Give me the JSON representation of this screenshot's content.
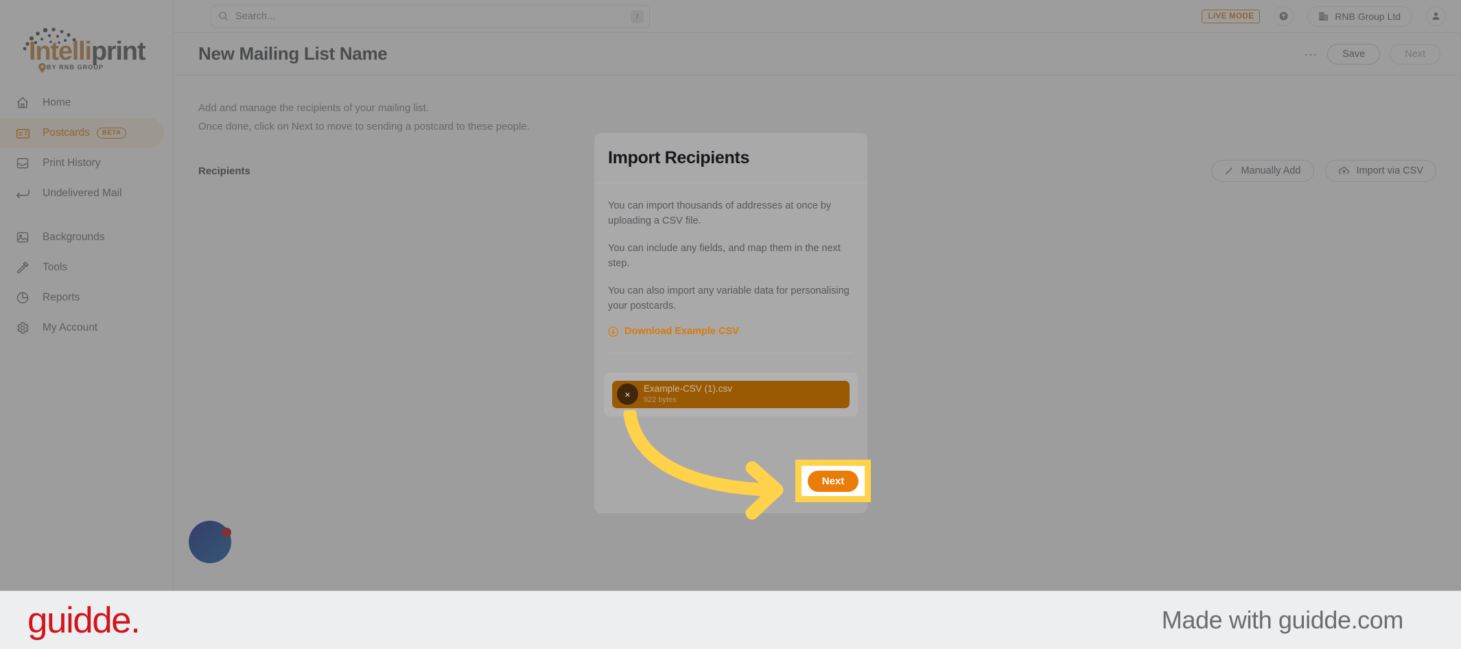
{
  "brand": {
    "logo_primary": "Intelli",
    "logo_secondary": "print",
    "logo_tagline": "BY RNB GROUP",
    "accent_orange": "#e2820f",
    "accent_brown": "#c4884b",
    "highlight_yellow": "#ffd24a",
    "next_button_orange": "#ec7c09"
  },
  "topbar": {
    "search": {
      "placeholder": "Search...",
      "shortcut": "/"
    },
    "live_mode_label": "LIVE MODE",
    "org_name": "RNB Group Ltd"
  },
  "sidebar": {
    "items": [
      {
        "label": "Home",
        "icon": "home-icon",
        "badge": "",
        "active": false
      },
      {
        "label": "Postcards",
        "icon": "postcard-icon",
        "badge": "BETA",
        "active": true
      },
      {
        "label": "Print History",
        "icon": "inbox-icon",
        "badge": "",
        "active": false
      },
      {
        "label": "Undelivered Mail",
        "icon": "return-arrow-icon",
        "badge": "",
        "active": false
      },
      {
        "label": "Backgrounds",
        "icon": "image-icon",
        "badge": "",
        "active": false
      },
      {
        "label": "Tools",
        "icon": "hammer-icon",
        "badge": "",
        "active": false
      },
      {
        "label": "Reports",
        "icon": "pie-chart-icon",
        "badge": "",
        "active": false
      },
      {
        "label": "My Account",
        "icon": "gear-icon",
        "badge": "",
        "active": false
      }
    ]
  },
  "page": {
    "title": "New Mailing List Name",
    "more_label": "...",
    "save_label": "Save",
    "next_label": "Next",
    "description_line1": "Add and manage the recipients of your mailing list.",
    "description_line2": "Once done, click on Next to move to sending a postcard to these people.",
    "recipients_heading": "Recipients",
    "manually_add_label": "Manually Add",
    "import_csv_label": "Import via CSV"
  },
  "modal": {
    "title": "Import Recipients",
    "paragraph1": "You can import thousands of addresses at once by uploading a CSV file.",
    "paragraph2": "You can include any fields, and map them in the next step.",
    "paragraph3": "You can also import any variable data for personalising your postcards.",
    "download_link": "Download Example CSV",
    "file": {
      "name": "Example-CSV (1).csv",
      "size": "922 bytes",
      "remove_label": "×"
    },
    "next_button": "Next"
  },
  "footer": {
    "logo": "guidde.",
    "made_with": "Made with guidde.com"
  }
}
